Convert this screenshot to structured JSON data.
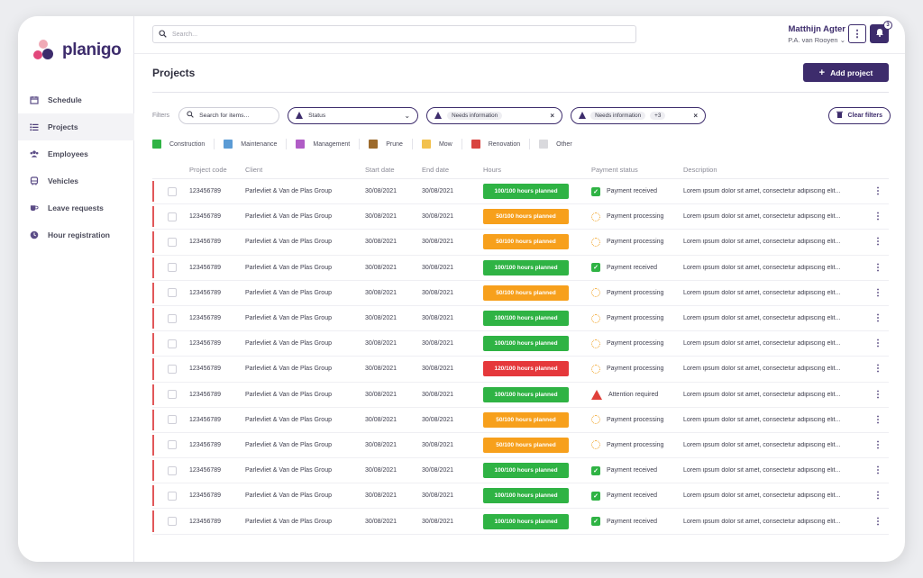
{
  "app": {
    "logo_text": "planigo"
  },
  "sidebar": {
    "items": [
      {
        "label": "Schedule",
        "icon": "calendar-icon"
      },
      {
        "label": "Projects",
        "icon": "list-icon",
        "active": true
      },
      {
        "label": "Employees",
        "icon": "people-icon"
      },
      {
        "label": "Vehicles",
        "icon": "bus-icon"
      },
      {
        "label": "Leave requests",
        "icon": "cup-icon"
      },
      {
        "label": "Hour registration",
        "icon": "clock-icon"
      }
    ]
  },
  "topbar": {
    "search_placeholder": "Search...",
    "user_name": "Matthijn Agter",
    "user_org": "P.A. van Rooyen",
    "notification_count": "3"
  },
  "page": {
    "title": "Projects",
    "add_button_label": "Add project"
  },
  "filters": {
    "label": "Filters",
    "search_placeholder": "Search for items...",
    "status_dropdown_label": "Status",
    "filter1_chip": "Needs information",
    "filter2_chip": "Needs information",
    "filter2_more": "+3",
    "clear_label": "Clear filters"
  },
  "legend": [
    {
      "label": "Construction",
      "color": "#2fb344"
    },
    {
      "label": "Maintenance",
      "color": "#5b9bd5"
    },
    {
      "label": "Management",
      "color": "#b05cc6"
    },
    {
      "label": "Prune",
      "color": "#9c6a2b"
    },
    {
      "label": "Mow",
      "color": "#f2c14e"
    },
    {
      "label": "Renovation",
      "color": "#d9443f"
    },
    {
      "label": "Other",
      "color": "#d9d9dd"
    }
  ],
  "table": {
    "columns": [
      "Project code",
      "Client",
      "Start date",
      "End date",
      "Hours",
      "Payment status",
      "Description"
    ],
    "rows": [
      {
        "code": "123456789",
        "client": "Parlevliet & Van de Plas Group",
        "start": "30/08/2021",
        "end": "30/08/2021",
        "hours": "100/100 hours planned",
        "hours_color": "#2fb344",
        "status": "Payment received",
        "status_type": "received",
        "desc": "Lorem ipsum dolor sit amet, consectetur adipiscing elit..."
      },
      {
        "code": "123456789",
        "client": "Parlevliet & Van de Plas Group",
        "start": "30/08/2021",
        "end": "30/08/2021",
        "hours": "50/100 hours planned",
        "hours_color": "#f7a01c",
        "status": "Payment processing",
        "status_type": "processing",
        "desc": "Lorem ipsum dolor sit amet, consectetur adipiscing elit..."
      },
      {
        "code": "123456789",
        "client": "Parlevliet & Van de Plas Group",
        "start": "30/08/2021",
        "end": "30/08/2021",
        "hours": "50/100 hours planned",
        "hours_color": "#f7a01c",
        "status": "Payment processing",
        "status_type": "processing",
        "desc": "Lorem ipsum dolor sit amet, consectetur adipiscing elit..."
      },
      {
        "code": "123456789",
        "client": "Parlevliet & Van de Plas Group",
        "start": "30/08/2021",
        "end": "30/08/2021",
        "hours": "100/100 hours planned",
        "hours_color": "#2fb344",
        "status": "Payment received",
        "status_type": "received",
        "desc": "Lorem ipsum dolor sit amet, consectetur adipiscing elit..."
      },
      {
        "code": "123456789",
        "client": "Parlevliet & Van de Plas Group",
        "start": "30/08/2021",
        "end": "30/08/2021",
        "hours": "50/100 hours planned",
        "hours_color": "#f7a01c",
        "status": "Payment processing",
        "status_type": "processing",
        "desc": "Lorem ipsum dolor sit amet, consectetur adipiscing elit..."
      },
      {
        "code": "123456789",
        "client": "Parlevliet & Van de Plas Group",
        "start": "30/08/2021",
        "end": "30/08/2021",
        "hours": "100/100 hours planned",
        "hours_color": "#2fb344",
        "status": "Payment processing",
        "status_type": "processing",
        "desc": "Lorem ipsum dolor sit amet, consectetur adipiscing elit..."
      },
      {
        "code": "123456789",
        "client": "Parlevliet & Van de Plas Group",
        "start": "30/08/2021",
        "end": "30/08/2021",
        "hours": "100/100 hours planned",
        "hours_color": "#2fb344",
        "status": "Payment processing",
        "status_type": "processing",
        "desc": "Lorem ipsum dolor sit amet, consectetur adipiscing elit..."
      },
      {
        "code": "123456789",
        "client": "Parlevliet & Van de Plas Group",
        "start": "30/08/2021",
        "end": "30/08/2021",
        "hours": "120/100 hours planned",
        "hours_color": "#e5383b",
        "status": "Payment processing",
        "status_type": "processing",
        "desc": "Lorem ipsum dolor sit amet, consectetur adipiscing elit..."
      },
      {
        "code": "123456789",
        "client": "Parlevliet & Van de Plas Group",
        "start": "30/08/2021",
        "end": "30/08/2021",
        "hours": "100/100 hours planned",
        "hours_color": "#2fb344",
        "status": "Attention required",
        "status_type": "attention",
        "desc": "Lorem ipsum dolor sit amet, consectetur adipiscing elit..."
      },
      {
        "code": "123456789",
        "client": "Parlevliet & Van de Plas Group",
        "start": "30/08/2021",
        "end": "30/08/2021",
        "hours": "50/100 hours planned",
        "hours_color": "#f7a01c",
        "status": "Payment processing",
        "status_type": "processing",
        "desc": "Lorem ipsum dolor sit amet, consectetur adipiscing elit..."
      },
      {
        "code": "123456789",
        "client": "Parlevliet & Van de Plas Group",
        "start": "30/08/2021",
        "end": "30/08/2021",
        "hours": "50/100 hours planned",
        "hours_color": "#f7a01c",
        "status": "Payment processing",
        "status_type": "processing",
        "desc": "Lorem ipsum dolor sit amet, consectetur adipiscing elit..."
      },
      {
        "code": "123456789",
        "client": "Parlevliet & Van de Plas Group",
        "start": "30/08/2021",
        "end": "30/08/2021",
        "hours": "100/100 hours planned",
        "hours_color": "#2fb344",
        "status": "Payment received",
        "status_type": "received",
        "desc": "Lorem ipsum dolor sit amet, consectetur adipiscing elit..."
      },
      {
        "code": "123456789",
        "client": "Parlevliet & Van de Plas Group",
        "start": "30/08/2021",
        "end": "30/08/2021",
        "hours": "100/100 hours planned",
        "hours_color": "#2fb344",
        "status": "Payment received",
        "status_type": "received",
        "desc": "Lorem ipsum dolor sit amet, consectetur adipiscing elit..."
      },
      {
        "code": "123456789",
        "client": "Parlevliet & Van de Plas Group",
        "start": "30/08/2021",
        "end": "30/08/2021",
        "hours": "100/100 hours planned",
        "hours_color": "#2fb344",
        "status": "Payment received",
        "status_type": "received",
        "desc": "Lorem ipsum dolor sit amet, consectetur adipiscing elit..."
      }
    ]
  }
}
